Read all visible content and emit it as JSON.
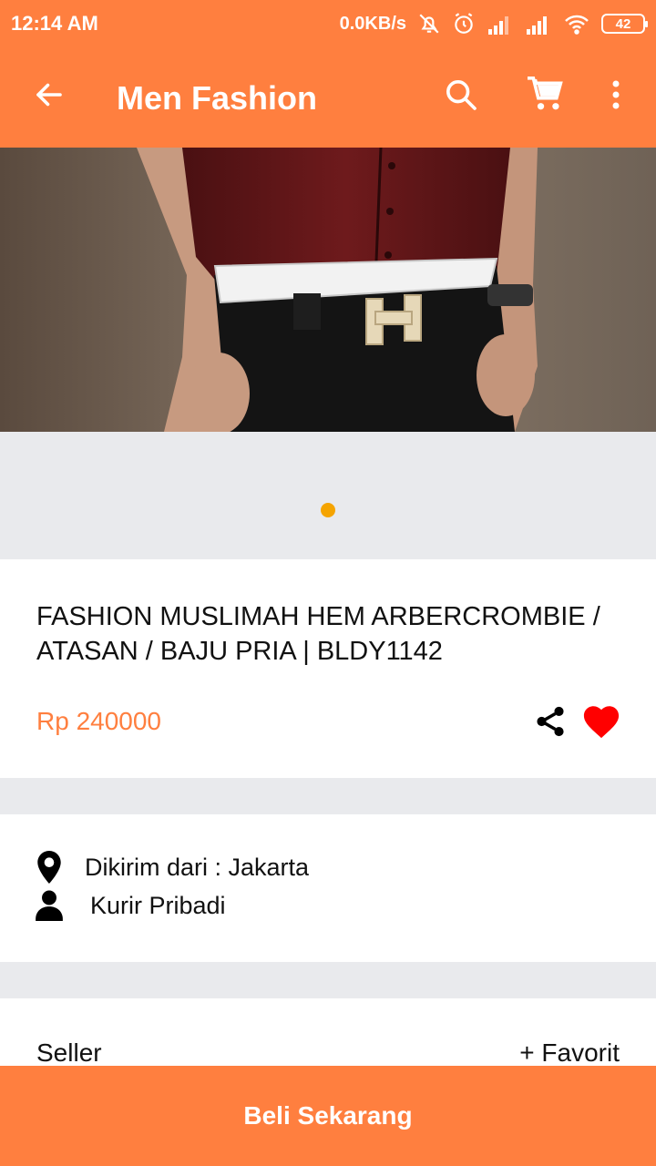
{
  "status_bar": {
    "time": "12:14 AM",
    "net_speed": "0.0KB/s",
    "battery": "42",
    "icons": [
      "mute-notification-icon",
      "alarm-icon",
      "signal-icon",
      "signal-icon",
      "wifi-icon",
      "battery-icon"
    ]
  },
  "app_bar": {
    "title": "Men Fashion",
    "icons": [
      "back-arrow-icon",
      "search-icon",
      "cart-icon",
      "more-vert-icon"
    ]
  },
  "carousel": {
    "image": "product-photo-belt",
    "active_index": 0
  },
  "product": {
    "name": "FASHION MUSLIMAH HEM ARBERCROMBIE / ATASAN / BAJU PRIA | BLDY1142",
    "price": "Rp 240000",
    "icons": [
      "share-icon",
      "heart-icon"
    ]
  },
  "shipping": {
    "origin": "Dikirim dari : Jakarta",
    "courier": "Kurir Pribadi",
    "icons": [
      "location-pin-icon",
      "person-icon"
    ]
  },
  "seller": {
    "label": "Seller",
    "favorite_label": "+ Favorit"
  },
  "buy_button": {
    "label": "Beli Sekarang"
  },
  "colors": {
    "accent": "#ff7f3f",
    "dot": "#f5a400",
    "heart": "#ff0000",
    "background": "#e9eaed"
  }
}
